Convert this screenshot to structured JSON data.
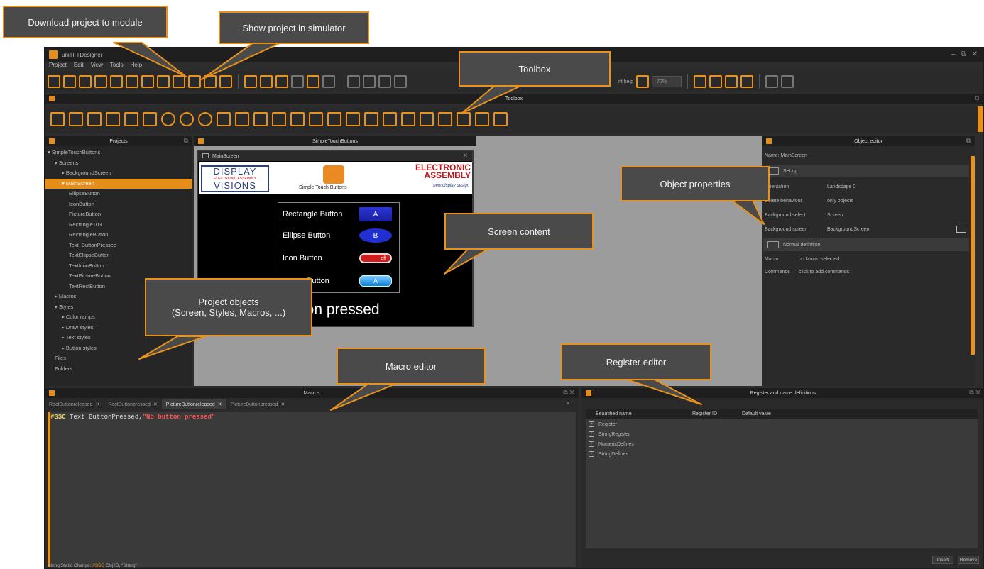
{
  "app": {
    "title": "uniTFTDesigner"
  },
  "window_controls": {
    "minimize": "–",
    "restore": "⧉",
    "close": "✕"
  },
  "menu": [
    "Project",
    "Edit",
    "View",
    "Tools",
    "Help"
  ],
  "toolbar": {
    "help_label": "nt help",
    "zoom_value": "70%"
  },
  "toolbox": {
    "title": "Toolbox"
  },
  "projects": {
    "title": "Projects",
    "tree": [
      {
        "label": "▾ SimpleTouchButtons",
        "indent": 0
      },
      {
        "label": "▾ Screens",
        "indent": 1
      },
      {
        "label": "▸ BackgroundScreen",
        "indent": 2
      },
      {
        "label": "▾ MainScreen",
        "indent": 2,
        "selected": true
      },
      {
        "label": "EllipseButton",
        "indent": 3
      },
      {
        "label": "IconButton",
        "indent": 3
      },
      {
        "label": "PictureButton",
        "indent": 3
      },
      {
        "label": "Rectangle103",
        "indent": 3
      },
      {
        "label": "RectangleButton",
        "indent": 3
      },
      {
        "label": "Text_ButtonPressed",
        "indent": 3
      },
      {
        "label": "TextEllipseButton",
        "indent": 3
      },
      {
        "label": "TextIconButton",
        "indent": 3
      },
      {
        "label": "TextPictureButton",
        "indent": 3
      },
      {
        "label": "TextRectButton",
        "indent": 3
      },
      {
        "label": "▸ Macros",
        "indent": 1
      },
      {
        "label": "▾ Styles",
        "indent": 1
      },
      {
        "label": "▸ Color ramps",
        "indent": 2
      },
      {
        "label": "▸ Draw styles",
        "indent": 2
      },
      {
        "label": "▸ Text styles",
        "indent": 2
      },
      {
        "label": "▸ Button styles",
        "indent": 2
      },
      {
        "label": "Files",
        "indent": 1
      },
      {
        "label": "Folders",
        "indent": 1
      }
    ]
  },
  "editor": {
    "tab_title": "SimpleTouchButtons",
    "screen_title": "MainScreen",
    "banner": {
      "dv_top": "DISPLAY",
      "dv_mid": "ELECTRONIC ASSEMBLY",
      "dv_bot": "VISIONS",
      "center_text": "Simple Touch Buttons",
      "ea_line1": "ELECTRONIC",
      "ea_line2": "ASSEMBLY",
      "ea_sub": "new display design"
    },
    "buttons": [
      {
        "label": "Rectangle Button",
        "value": "A"
      },
      {
        "label": "Ellipse Button",
        "value": "B"
      },
      {
        "label": "Icon Button",
        "value": "off"
      },
      {
        "label": "Button",
        "value": "A"
      }
    ],
    "pressed_text": "tton pressed"
  },
  "object_editor": {
    "title": "Object editor",
    "name_row": "Name: MainScreen",
    "setup_label": "Set up",
    "props": [
      {
        "k": "Orientation",
        "v": "Landscape 0"
      },
      {
        "k": "Delete behaviour",
        "v": "only objects"
      },
      {
        "k": "Background select",
        "v": "Screen"
      },
      {
        "k": "Background screen",
        "v": "BackgroundScreen"
      }
    ],
    "macro_section": "Normal definition",
    "macro_rows": [
      {
        "k": "Macro",
        "v": "no Macro selected"
      },
      {
        "k": "Commands",
        "v": "click to add commands"
      }
    ]
  },
  "macros": {
    "title": "Macros",
    "tabs": [
      {
        "label": "RectButtonreleased",
        "active": false
      },
      {
        "label": "RectButtonpressed",
        "active": false
      },
      {
        "label": "PictureButtonreleased",
        "active": true
      },
      {
        "label": "PictureButtonpressed",
        "active": false
      }
    ],
    "code_kw": "#SSC",
    "code_mid": " Text_ButtonPressed,",
    "code_str": "\"No button pressed\"",
    "status_prefix": "String Static Change: ",
    "status_kw": "#SSC",
    "status_rest": " Obj ID, \"String\""
  },
  "registers": {
    "title": "Register and name definitions",
    "columns": [
      "Beautified name",
      "Register ID",
      "Default value"
    ],
    "items": [
      "Register",
      "StringRegister",
      "NumericDefines",
      "StringDefines"
    ],
    "insert_label": "Insert",
    "remove_label": "Remove"
  },
  "callouts": {
    "download": "Download project to module",
    "simulator": "Show project in simulator",
    "toolbox": "Toolbox",
    "object_props": "Object properties",
    "screen_content": "Screen content",
    "project_objects_1": "Project objects",
    "project_objects_2": "(Screen, Styles, Macros, ...)",
    "macro_editor": "Macro editor",
    "register_editor": "Register editor"
  },
  "colors": {
    "accent": "#e8921c",
    "window_bg": "#2d2d2d",
    "panel_header": "#1e1e1e"
  }
}
